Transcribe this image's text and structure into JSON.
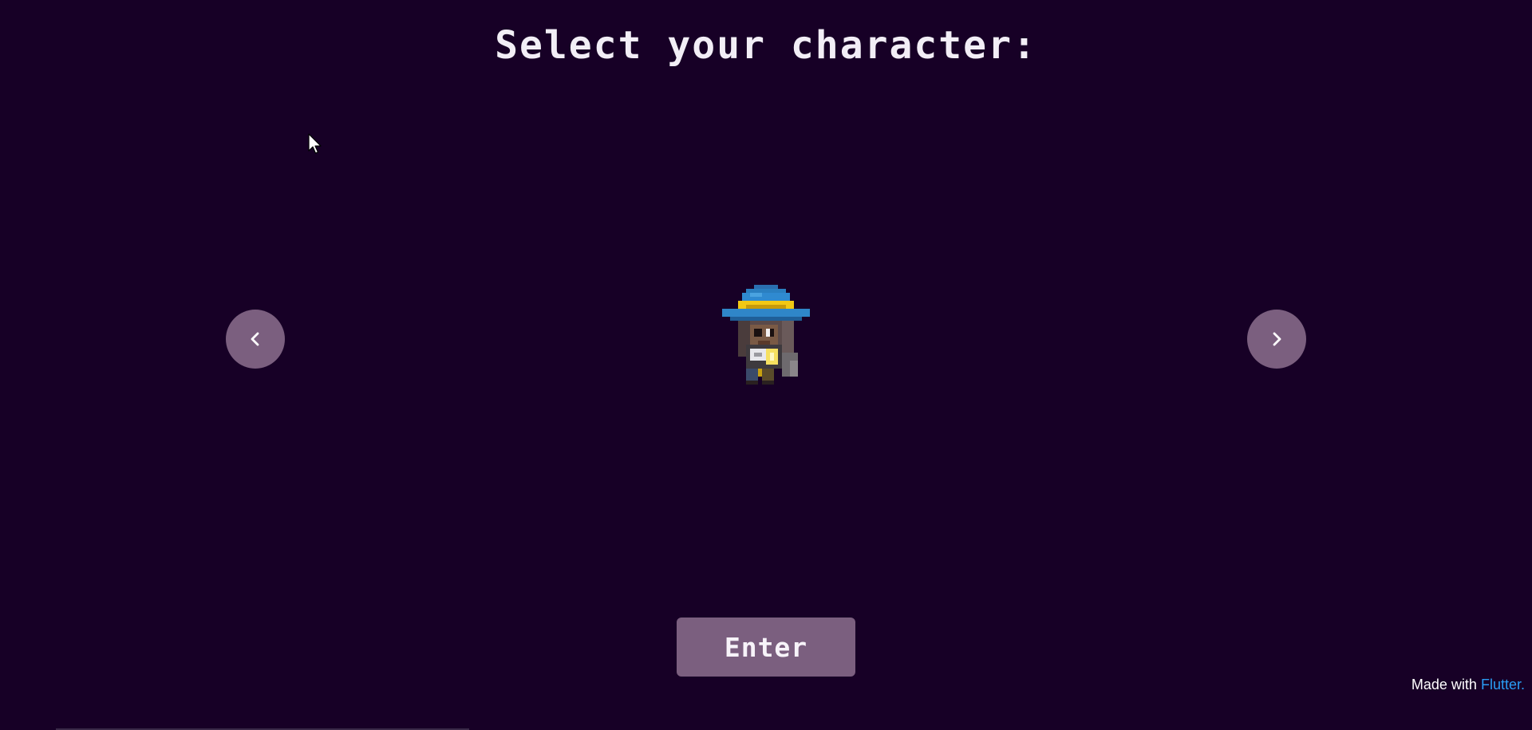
{
  "screen": {
    "title": "Select your character:",
    "background_color": "#170026"
  },
  "navigation": {
    "prev_icon": "chevron-left-icon",
    "next_icon": "chevron-right-icon",
    "button_color": "#7b5f7f"
  },
  "character": {
    "sprite": "wizard-character-sprite",
    "hat_color": "#2a7fc0",
    "hat_band_color": "#f2c814"
  },
  "actions": {
    "enter_label": "Enter"
  },
  "footer": {
    "made_with_label": "Made with",
    "brand_label": "Flutter.",
    "brand_color": "#2a9df4"
  }
}
